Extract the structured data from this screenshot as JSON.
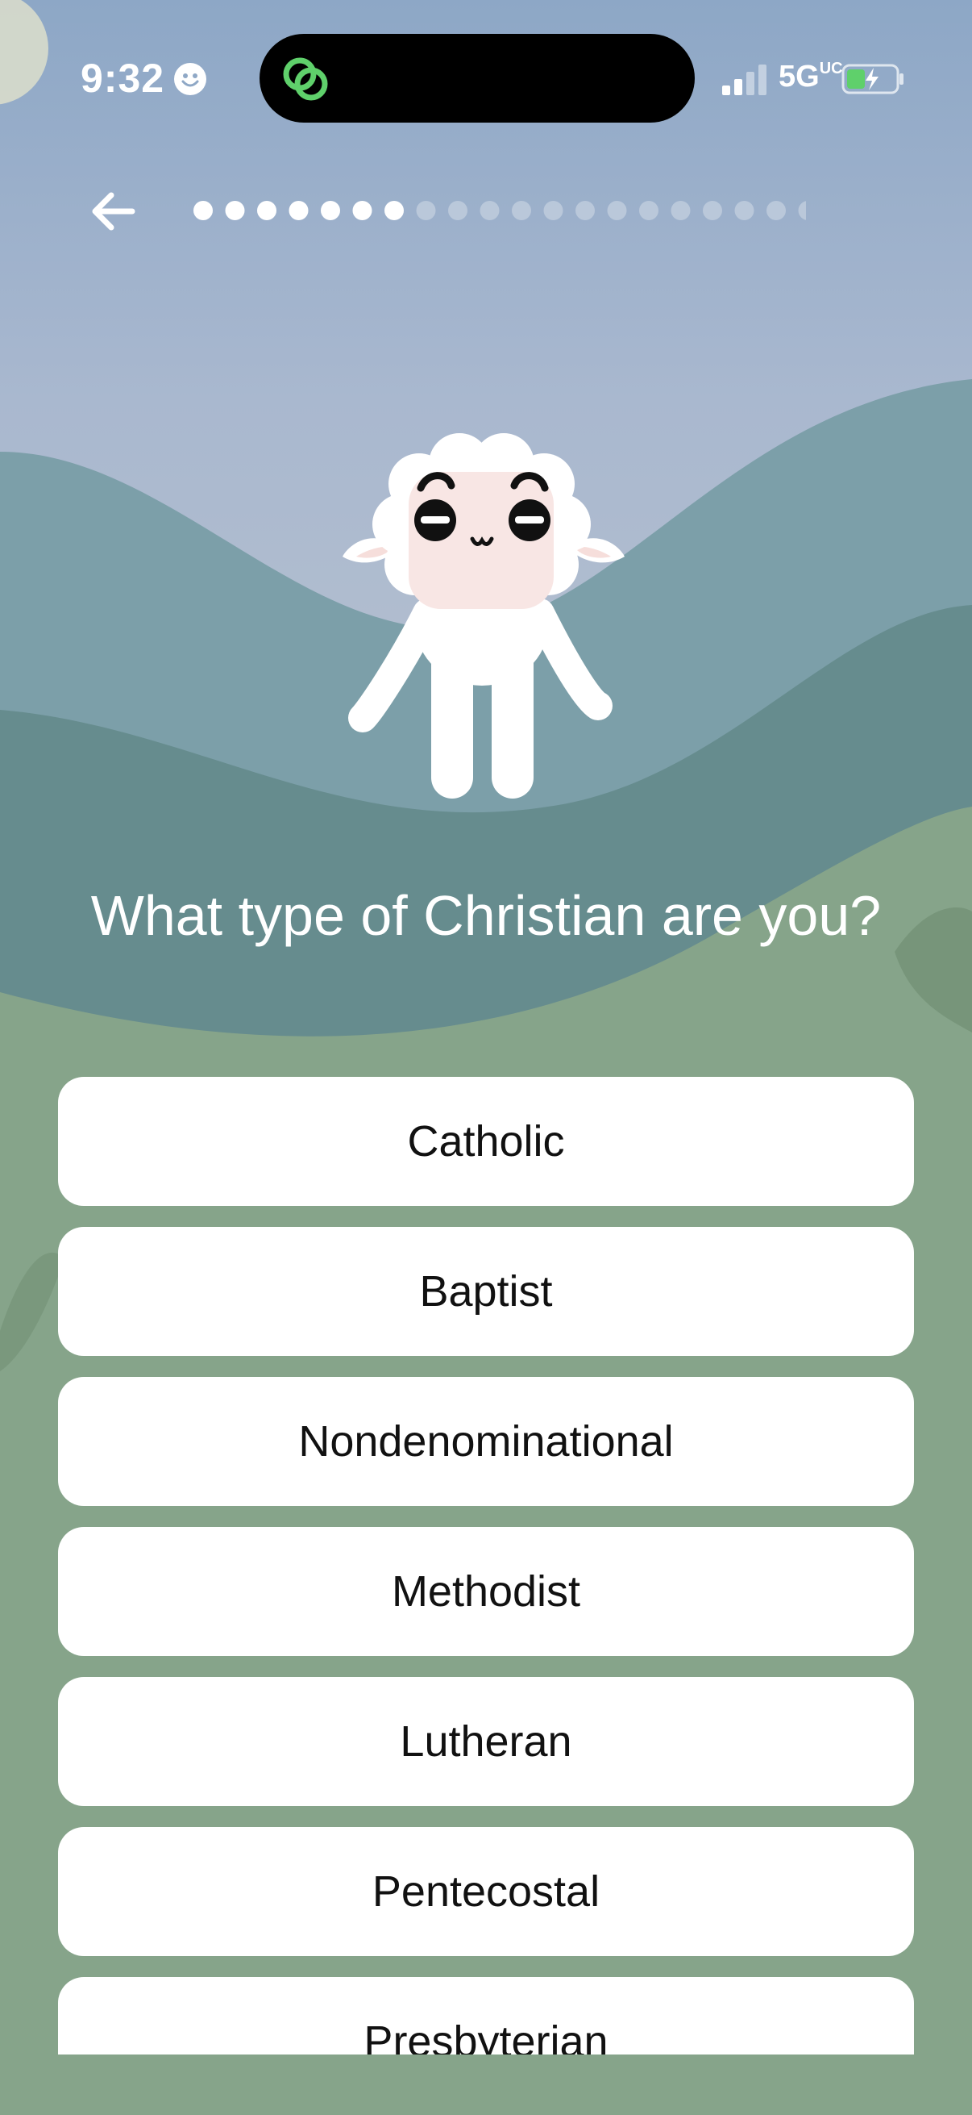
{
  "status_bar": {
    "time": "9:32",
    "network": "5G",
    "network_suffix": "UC"
  },
  "icons": {
    "back": "arrow-left-icon",
    "app_indicator": "link-icon",
    "status_face": "smiley-icon",
    "battery": "battery-charging-icon",
    "signal": "signal-icon"
  },
  "progress": {
    "total_steps": 20,
    "completed_steps": 7
  },
  "question": {
    "text": "What type of Christian are you?"
  },
  "options": [
    {
      "label": "Catholic"
    },
    {
      "label": "Baptist"
    },
    {
      "label": "Nondenominational"
    },
    {
      "label": "Methodist"
    },
    {
      "label": "Lutheran"
    },
    {
      "label": "Pentecostal"
    },
    {
      "label": "Presbyterian"
    }
  ],
  "colors": {
    "sky_top": "#8fa8c6",
    "hill_back": "#6f9aa3",
    "hill_front": "#5e8a8b",
    "meadow": "#86a48a",
    "indicator_green": "#5fd06b",
    "button_bg": "#ffffff",
    "text_dark": "#111111"
  }
}
